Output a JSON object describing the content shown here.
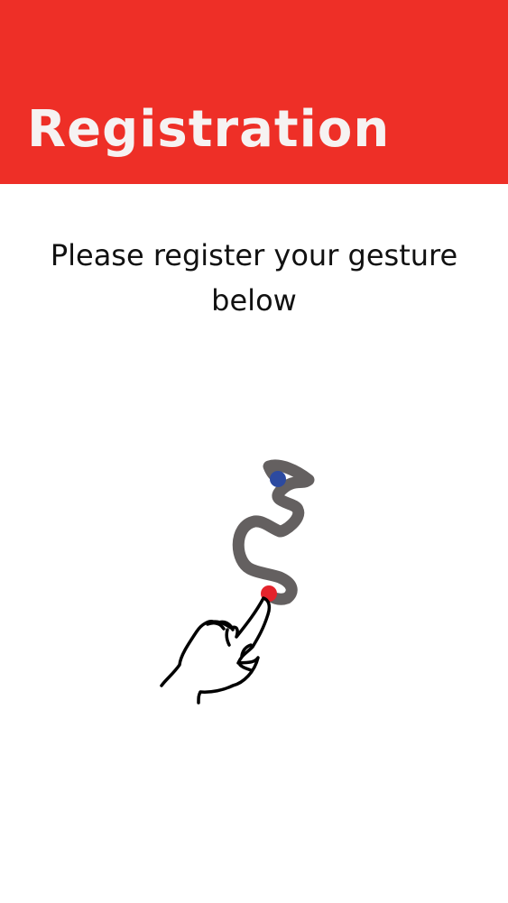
{
  "header": {
    "title": "Registration",
    "background_color": "#ee2f27"
  },
  "main": {
    "instruction": "Please register your gesture below"
  },
  "gesture_illustration": {
    "path_color": "#646060",
    "start_dot_color": "#2c4aa0",
    "end_dot_color": "#e4232b",
    "hand_icon": "pointing-hand-icon"
  }
}
